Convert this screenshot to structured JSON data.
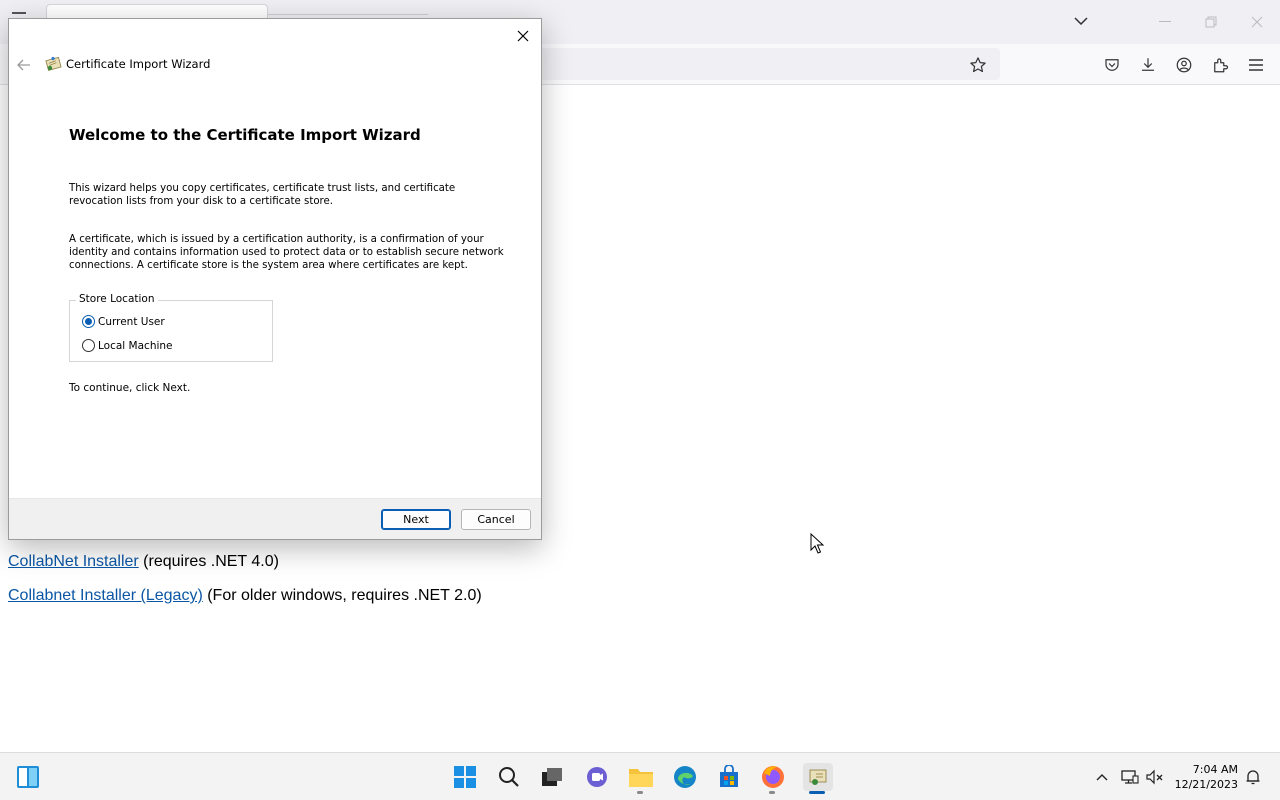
{
  "dialog": {
    "title": "Certificate Import Wizard",
    "heading": "Welcome to the Certificate Import Wizard",
    "paragraph1": "This wizard helps you copy certificates, certificate trust lists, and certificate revocation lists from your disk to a certificate store.",
    "paragraph2": "A certificate, which is issued by a certification authority, is a confirmation of your identity and contains information used to protect data or to establish secure network connections. A certificate store is the system area where certificates are kept.",
    "store_location": {
      "legend": "Store Location",
      "options": [
        {
          "label": "Current User",
          "checked": true
        },
        {
          "label": "Local Machine",
          "checked": false
        }
      ]
    },
    "continue_text": "To continue, click Next.",
    "next_label": "Next",
    "cancel_label": "Cancel"
  },
  "page": {
    "downloads": [
      {
        "link": "CollabNet Installer",
        "note": " (requires .NET 4.0)"
      },
      {
        "link": "Collabnet Installer (Legacy)",
        "note": " (For older windows, requires .NET 2.0)"
      }
    ]
  },
  "taskbar": {
    "icons": [
      "windows-start-icon",
      "search-icon",
      "task-view-icon",
      "chat-icon",
      "file-explorer-icon",
      "edge-icon",
      "store-icon",
      "firefox-icon",
      "certificate-wizard-icon"
    ],
    "tray": [
      "chevron-up-icon",
      "network-icon",
      "volume-muted-icon",
      "notification-icon"
    ],
    "time": "7:04 AM",
    "date": "12/21/2023"
  },
  "colors": {
    "accent": "#0a5fb4",
    "link": "#0b57a5",
    "taskbar": "#f3f3f3"
  }
}
